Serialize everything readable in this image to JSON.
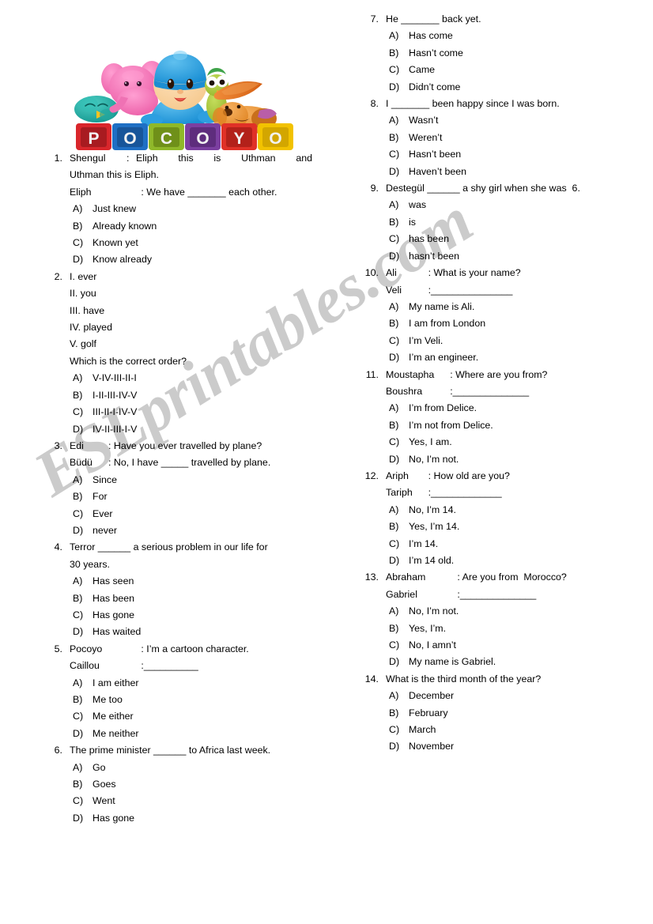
{
  "document": {
    "type": "esl-worksheet",
    "watermark": "ESLprintables.com"
  },
  "clipart": {
    "name": "pocoyo-characters-with-blocks",
    "blocks": [
      {
        "letter": "P",
        "color": "#d9262b"
      },
      {
        "letter": "O",
        "color": "#1f6fc4"
      },
      {
        "letter": "C",
        "color": "#8fb829"
      },
      {
        "letter": "O",
        "color": "#7b3fa0"
      },
      {
        "letter": "Y",
        "color": "#e03127"
      },
      {
        "letter": "O",
        "color": "#f2c200"
      }
    ],
    "characters": [
      {
        "name": "elly-elephant",
        "color": "#f06ab0"
      },
      {
        "name": "sleepy-bird",
        "color": "#1fa9a0"
      },
      {
        "name": "pocoyo-boy",
        "color": "#2e9fe0"
      },
      {
        "name": "pato-duck",
        "color": "#a8c83c"
      },
      {
        "name": "loula-dog",
        "color": "#e8962e"
      },
      {
        "name": "surfboard",
        "color": "#e2701d"
      }
    ]
  },
  "left_column": {
    "questions": [
      {
        "number": "1.",
        "lines": [
          {
            "kind": "dialogue",
            "speaker": "Shengul",
            "pad": 10,
            "text": ": Eliph   this   is   Uthman   and",
            "justify": true
          },
          {
            "kind": "plain",
            "text": "Uthman this is Eliph."
          },
          {
            "kind": "dialogue",
            "speaker": "Eliph",
            "pad": 14,
            "text": ": We have _______ each other."
          }
        ],
        "options": [
          {
            "key": "A)",
            "text": "Just knew"
          },
          {
            "key": "B)",
            "text": "Already known"
          },
          {
            "key": "C)",
            "text": "Known yet"
          },
          {
            "key": "D)",
            "text": "Know already"
          }
        ]
      },
      {
        "number": "2.",
        "lines": [
          {
            "kind": "plain",
            "text": "I. ever"
          },
          {
            "kind": "plain",
            "text": "II. you"
          },
          {
            "kind": "plain",
            "text": "III. have"
          },
          {
            "kind": "plain",
            "text": "IV. played"
          },
          {
            "kind": "plain",
            "text": "V. golf"
          },
          {
            "kind": "plain",
            "text": "Which is the correct order?"
          }
        ],
        "options": [
          {
            "key": "A)",
            "text": "V-IV-III-II-I"
          },
          {
            "key": "B)",
            "text": "I-II-III-IV-V"
          },
          {
            "key": "C)",
            "text": "III-II-I-IV-V"
          },
          {
            "key": "D)",
            "text": "IV-II-III-I-V"
          }
        ]
      },
      {
        "number": "3.",
        "lines": [
          {
            "kind": "dialogue",
            "speaker": "Edi",
            "pad": 5,
            "text": ": Have you ever travelled by plane?"
          },
          {
            "kind": "dialogue",
            "speaker": "Büdü",
            "pad": 5,
            "text": ": No, I have _____ travelled by plane."
          }
        ],
        "options": [
          {
            "key": "A)",
            "text": "Since"
          },
          {
            "key": "B)",
            "text": "For"
          },
          {
            "key": "C)",
            "text": "Ever"
          },
          {
            "key": "D)",
            "text": "never"
          }
        ]
      },
      {
        "number": "4.",
        "lines": [
          {
            "kind": "plain",
            "text": "Terror ______ a serious problem in our life for"
          },
          {
            "kind": "plain",
            "text": "30 years."
          }
        ],
        "options": [
          {
            "key": "A)",
            "text": "Has seen"
          },
          {
            "key": "B)",
            "text": "Has been"
          },
          {
            "key": "C)",
            "text": "Has gone"
          },
          {
            "key": "D)",
            "text": "Has waited"
          }
        ]
      },
      {
        "number": "5.",
        "lines": [
          {
            "kind": "dialogue",
            "speaker": "Pocoyo",
            "pad": 14,
            "text": ": I’m a cartoon character."
          },
          {
            "kind": "dialogue",
            "speaker": "Caillou",
            "pad": 14,
            "text": ":__________"
          }
        ],
        "options": [
          {
            "key": "A)",
            "text": "I am either"
          },
          {
            "key": "B)",
            "text": "Me too"
          },
          {
            "key": "C)",
            "text": "Me either"
          },
          {
            "key": "D)",
            "text": "Me neither"
          }
        ]
      },
      {
        "number": "6.",
        "lines": [
          {
            "kind": "plain",
            "text": "The prime minister ______ to Africa last week."
          }
        ],
        "options": [
          {
            "key": "A)",
            "text": "Go"
          },
          {
            "key": "B)",
            "text": "Goes"
          },
          {
            "key": "C)",
            "text": "Went"
          },
          {
            "key": "D)",
            "text": "Has gone"
          }
        ]
      }
    ]
  },
  "right_column": {
    "questions": [
      {
        "number": "7.",
        "lines": [
          {
            "kind": "plain",
            "text": "He _______ back yet."
          }
        ],
        "options": [
          {
            "key": "A)",
            "text": "Has come"
          },
          {
            "key": "B)",
            "text": "Hasn’t come"
          },
          {
            "key": "C)",
            "text": "Came"
          },
          {
            "key": "D)",
            "text": "Didn’t come"
          }
        ]
      },
      {
        "number": "8.",
        "lines": [
          {
            "kind": "plain",
            "text": "I _______ been happy since I was born."
          }
        ],
        "options": [
          {
            "key": "A)",
            "text": "Wasn’t"
          },
          {
            "key": "B)",
            "text": "Weren’t"
          },
          {
            "key": "C)",
            "text": "Hasn’t been"
          },
          {
            "key": "D)",
            "text": "Haven’t been"
          }
        ]
      },
      {
        "number": "9.",
        "lines": [
          {
            "kind": "plain",
            "text": "Destegül ______ a shy girl when she was  6."
          }
        ],
        "options": [
          {
            "key": "A)",
            "text": "was"
          },
          {
            "key": "B)",
            "text": "is"
          },
          {
            "key": "C)",
            "text": "has been"
          },
          {
            "key": "D)",
            "text": "hasn’t been"
          }
        ]
      },
      {
        "number": "10.",
        "lines": [
          {
            "kind": "dialogue",
            "speaker": "Ali",
            "pad": 6,
            "text": ": What is your name?"
          },
          {
            "kind": "dialogue",
            "speaker": "Veli",
            "pad": 6,
            "text": ":_______________"
          }
        ],
        "options": [
          {
            "key": "A)",
            "text": "My name is Ali."
          },
          {
            "key": "B)",
            "text": "I am from London"
          },
          {
            "key": "C)",
            "text": "I’m Veli."
          },
          {
            "key": "D)",
            "text": "I’m an engineer."
          }
        ]
      },
      {
        "number": "11.",
        "lines": [
          {
            "kind": "dialogue",
            "speaker": "Moustapha",
            "pad": 12,
            "text": ": Where are you from?"
          },
          {
            "kind": "dialogue",
            "speaker": "Boushra",
            "pad": 12,
            "text": ":______________"
          }
        ],
        "options": [
          {
            "key": "A)",
            "text": "I’m from Delice."
          },
          {
            "key": "B)",
            "text": "I’m not from Delice."
          },
          {
            "key": "C)",
            "text": "Yes, I am."
          },
          {
            "key": "D)",
            "text": "No, I’m not."
          }
        ]
      },
      {
        "number": "12.",
        "lines": [
          {
            "kind": "dialogue",
            "speaker": "Ariph",
            "pad": 6,
            "text": ": How old are you?"
          },
          {
            "kind": "dialogue",
            "speaker": "Tariph",
            "pad": 6,
            "text": ":_____________"
          }
        ],
        "options": [
          {
            "key": "A)",
            "text": "No, I’m 14."
          },
          {
            "key": "B)",
            "text": "Yes, I’m 14."
          },
          {
            "key": "C)",
            "text": "I’m 14."
          },
          {
            "key": "D)",
            "text": "I’m 14 old."
          }
        ]
      },
      {
        "number": "13.",
        "lines": [
          {
            "kind": "dialogue",
            "speaker": "Abraham",
            "pad": 14,
            "text": ": Are you from  Morocco?"
          },
          {
            "kind": "dialogue",
            "speaker": "Gabriel",
            "pad": 14,
            "text": ":______________"
          }
        ],
        "options": [
          {
            "key": "A)",
            "text": "No, I’m not."
          },
          {
            "key": "B)",
            "text": "Yes, I’m."
          },
          {
            "key": "C)",
            "text": "No, I amn’t"
          },
          {
            "key": "D)",
            "text": "My name is Gabriel."
          }
        ]
      },
      {
        "number": "14.",
        "lines": [
          {
            "kind": "plain",
            "text": "What is the third month of the year?"
          }
        ],
        "options": [
          {
            "key": "A)",
            "text": "December"
          },
          {
            "key": "B)",
            "text": "February"
          },
          {
            "key": "C)",
            "text": "March"
          },
          {
            "key": "D)",
            "text": "November"
          }
        ]
      }
    ]
  }
}
